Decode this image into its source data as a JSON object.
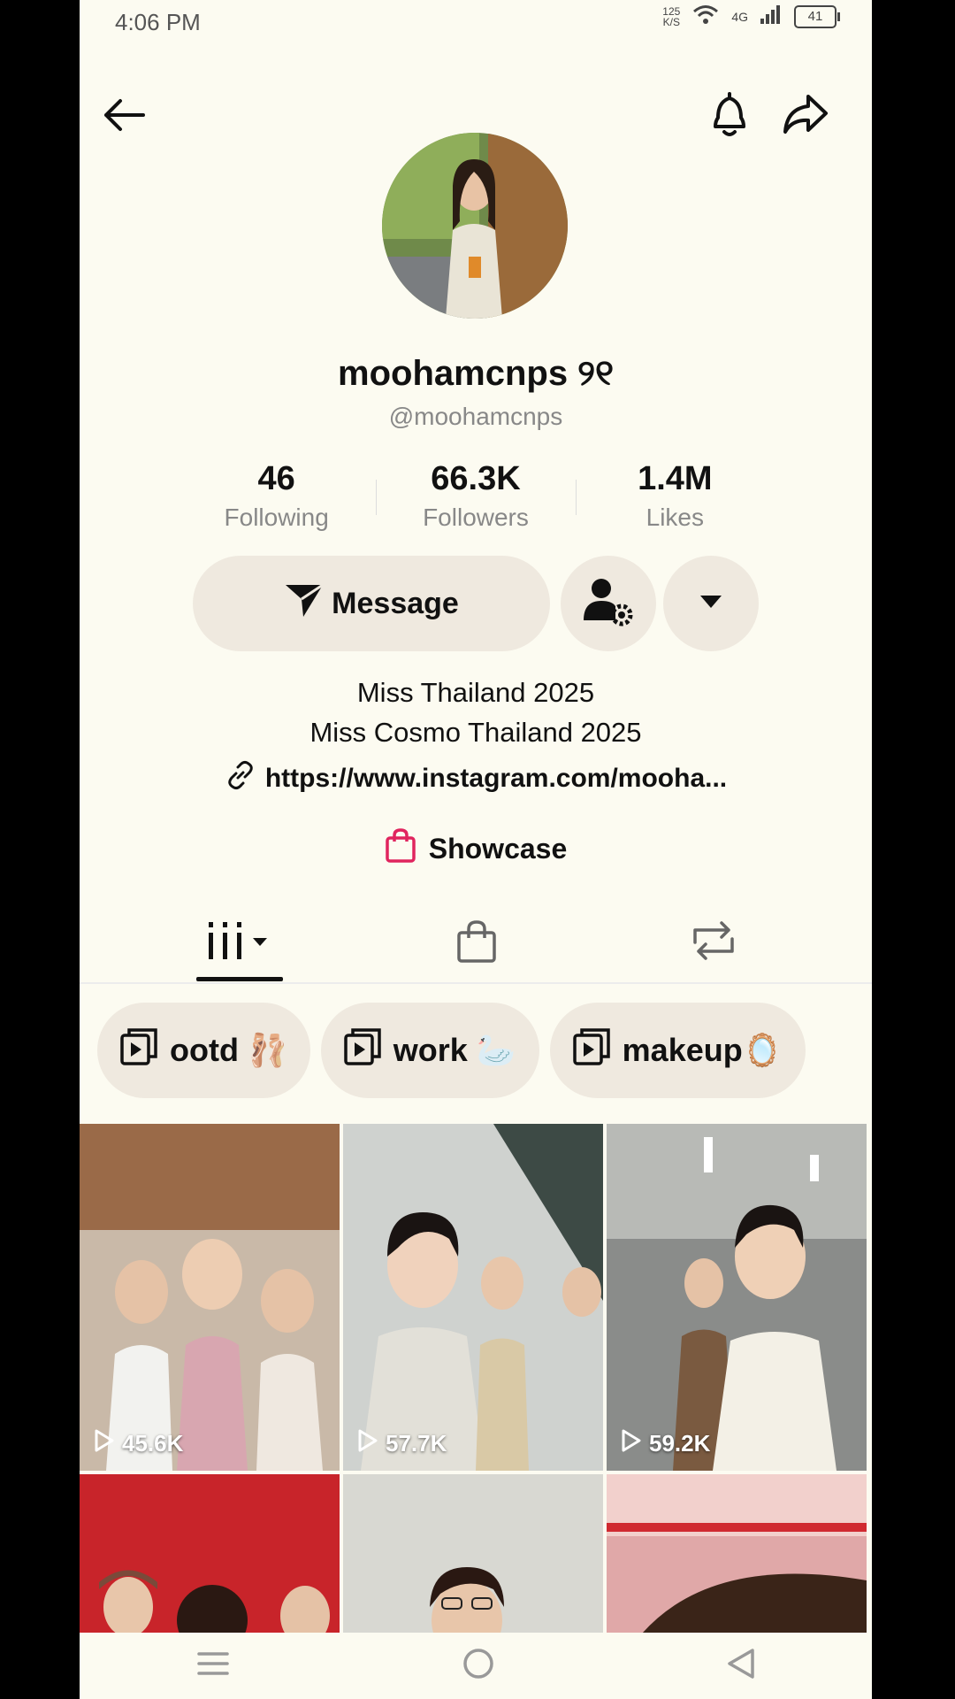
{
  "status": {
    "time": "4:06 PM",
    "net_speed_top": "125",
    "net_speed_bottom": "K/S",
    "network": "4G",
    "battery": "41"
  },
  "profile": {
    "name": "moohamcnps ୨୧",
    "handle": "@moohamcnps"
  },
  "stats": [
    {
      "value": "46",
      "label": "Following"
    },
    {
      "value": "66.3K",
      "label": "Followers"
    },
    {
      "value": "1.4M",
      "label": "Likes"
    }
  ],
  "actions": {
    "message_label": "Message"
  },
  "bio": {
    "line1": "Miss Thailand 2025",
    "line2": "Miss Cosmo Thailand 2025",
    "link": "https://www.instagram.com/mooha..."
  },
  "showcase": {
    "label": "Showcase"
  },
  "playlists": [
    {
      "label": "ootd 🩰"
    },
    {
      "label": "work 🦢"
    },
    {
      "label": "makeup🪞"
    }
  ],
  "videos": [
    {
      "views": "45.6K"
    },
    {
      "views": "57.7K"
    },
    {
      "views": "59.2K"
    }
  ],
  "colors": {
    "background": "#fcfbf1",
    "button": "#efe9df",
    "showcase_icon": "#e0245e"
  }
}
